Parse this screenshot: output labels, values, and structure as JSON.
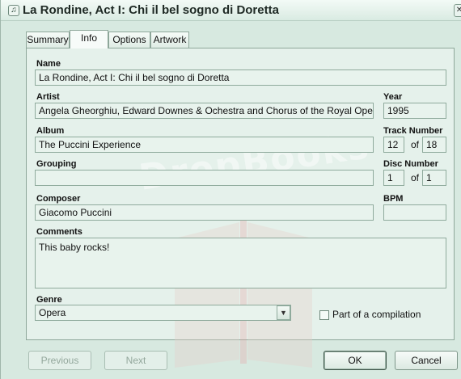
{
  "window": {
    "title": "La Rondine, Act I: Chi il bel sogno di Doretta",
    "close_glyph": "✕",
    "title_icon_glyph": "♫"
  },
  "watermark": "DropBooks",
  "tabs": [
    {
      "label": "Summary",
      "active": false
    },
    {
      "label": "Info",
      "active": true
    },
    {
      "label": "Options",
      "active": false
    },
    {
      "label": "Artwork",
      "active": false
    }
  ],
  "fields": {
    "name": {
      "label": "Name",
      "value": "La Rondine, Act I: Chi il bel sogno di Doretta"
    },
    "artist": {
      "label": "Artist",
      "value": "Angela Gheorghiu, Edward Downes & Ochestra and Chorus of the Royal Opera"
    },
    "year": {
      "label": "Year",
      "value": "1995"
    },
    "album": {
      "label": "Album",
      "value": "The Puccini Experience"
    },
    "track_number": {
      "label": "Track Number",
      "value": "12",
      "total": "18",
      "of": "of"
    },
    "grouping": {
      "label": "Grouping",
      "value": ""
    },
    "disc_number": {
      "label": "Disc Number",
      "value": "1",
      "total": "1",
      "of": "of"
    },
    "composer": {
      "label": "Composer",
      "value": "Giacomo Puccini"
    },
    "bpm": {
      "label": "BPM",
      "value": ""
    },
    "comments": {
      "label": "Comments",
      "value": "This baby rocks!"
    },
    "genre": {
      "label": "Genre",
      "value": "Opera",
      "dropdown_glyph": "▼"
    }
  },
  "compilation": {
    "label": "Part of a compilation",
    "checked": false
  },
  "buttons": {
    "previous": "Previous",
    "next": "Next",
    "ok": "OK",
    "cancel": "Cancel"
  }
}
